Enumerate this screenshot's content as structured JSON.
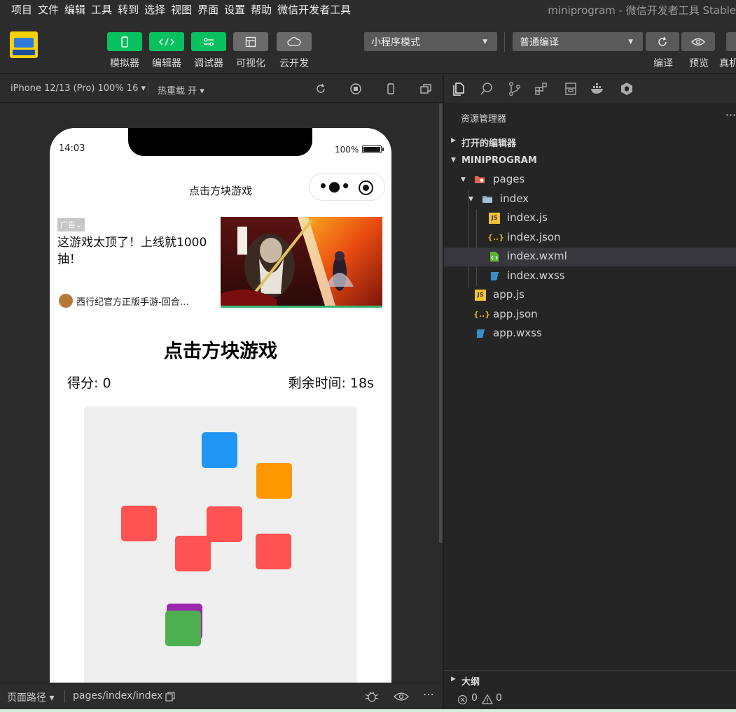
{
  "menubar": {
    "items": [
      "项目",
      "文件",
      "编辑",
      "工具",
      "转到",
      "选择",
      "视图",
      "界面",
      "设置",
      "帮助",
      "微信开发者工具"
    ],
    "window_title": "miniprogram - 微信开发者工具 Stable"
  },
  "toolbar": {
    "buttons": [
      {
        "label": "模拟器",
        "icon": "phone-icon",
        "active": true
      },
      {
        "label": "编辑器",
        "icon": "code-icon",
        "active": true
      },
      {
        "label": "调试器",
        "icon": "debug-icon",
        "active": true
      },
      {
        "label": "可视化",
        "icon": "layout-icon",
        "active": false
      },
      {
        "label": "云开发",
        "icon": "cloud-icon",
        "active": false
      }
    ],
    "mode_select": "小程序模式",
    "compile_select": "普通编译",
    "right_actions": [
      "编译",
      "预览",
      "真机"
    ]
  },
  "simbar": {
    "device": "iPhone 12/13 (Pro) 100% 16 ▾",
    "hot_reload": "热重载 开 ▾"
  },
  "phone": {
    "time": "14:03",
    "battery": "100%",
    "nav_title": "点击方块游戏",
    "ad": {
      "tag": "广告⌄",
      "title": "这游戏太顶了！上线就1000抽！",
      "source": "西行纪官方正版手游-回合…"
    },
    "game": {
      "title": "点击方块游戏",
      "score_text": "得分: 0",
      "timer_text": "剩余时间: 18s"
    }
  },
  "blocks": [
    {
      "color": "#2196f3"
    },
    {
      "color": "#ff9800"
    },
    {
      "color": "#ff5252"
    },
    {
      "color": "#ff5252"
    },
    {
      "color": "#ff5252"
    },
    {
      "color": "#ff5252"
    },
    {
      "color": "#9c27b0"
    },
    {
      "color": "#4caf50"
    }
  ],
  "statusbar": {
    "page_path_label": "页面路径 ▾",
    "page_path": "pages/index/index"
  },
  "explorer": {
    "header": "资源管理器",
    "more": "···",
    "open_editors": "打开的编辑器",
    "project": "MINIPROGRAM",
    "tree": [
      {
        "label": "pages",
        "type": "folder-special"
      },
      {
        "label": "index",
        "type": "folder"
      },
      {
        "label": "index.js",
        "type": "js"
      },
      {
        "label": "index.json",
        "type": "json"
      },
      {
        "label": "index.wxml",
        "type": "wxml",
        "selected": true
      },
      {
        "label": "index.wxss",
        "type": "wxss"
      },
      {
        "label": "app.js",
        "type": "js"
      },
      {
        "label": "app.json",
        "type": "json"
      },
      {
        "label": "app.wxss",
        "type": "wxss"
      }
    ],
    "outline": "大纲",
    "errors": "0",
    "warnings": "0"
  },
  "colors": {
    "green_button": "#07c160",
    "panel_bg": "#252526",
    "selected_row": "#37373d",
    "js_icon": "#f1c232",
    "json_icon": "#d4a72c",
    "wxml_icon": "#5fb336",
    "wxss_icon": "#3c9ce0"
  }
}
